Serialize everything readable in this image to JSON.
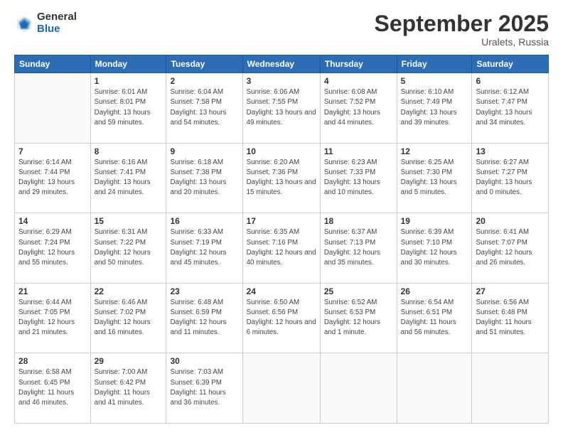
{
  "logo": {
    "general": "General",
    "blue": "Blue"
  },
  "header": {
    "title": "September 2025",
    "subtitle": "Uralets, Russia"
  },
  "days_of_week": [
    "Sunday",
    "Monday",
    "Tuesday",
    "Wednesday",
    "Thursday",
    "Friday",
    "Saturday"
  ],
  "weeks": [
    [
      {
        "day": "",
        "sunrise": "",
        "sunset": "",
        "daylight": ""
      },
      {
        "day": "1",
        "sunrise": "Sunrise: 6:01 AM",
        "sunset": "Sunset: 8:01 PM",
        "daylight": "Daylight: 13 hours and 59 minutes."
      },
      {
        "day": "2",
        "sunrise": "Sunrise: 6:04 AM",
        "sunset": "Sunset: 7:58 PM",
        "daylight": "Daylight: 13 hours and 54 minutes."
      },
      {
        "day": "3",
        "sunrise": "Sunrise: 6:06 AM",
        "sunset": "Sunset: 7:55 PM",
        "daylight": "Daylight: 13 hours and 49 minutes."
      },
      {
        "day": "4",
        "sunrise": "Sunrise: 6:08 AM",
        "sunset": "Sunset: 7:52 PM",
        "daylight": "Daylight: 13 hours and 44 minutes."
      },
      {
        "day": "5",
        "sunrise": "Sunrise: 6:10 AM",
        "sunset": "Sunset: 7:49 PM",
        "daylight": "Daylight: 13 hours and 39 minutes."
      },
      {
        "day": "6",
        "sunrise": "Sunrise: 6:12 AM",
        "sunset": "Sunset: 7:47 PM",
        "daylight": "Daylight: 13 hours and 34 minutes."
      }
    ],
    [
      {
        "day": "7",
        "sunrise": "Sunrise: 6:14 AM",
        "sunset": "Sunset: 7:44 PM",
        "daylight": "Daylight: 13 hours and 29 minutes."
      },
      {
        "day": "8",
        "sunrise": "Sunrise: 6:16 AM",
        "sunset": "Sunset: 7:41 PM",
        "daylight": "Daylight: 13 hours and 24 minutes."
      },
      {
        "day": "9",
        "sunrise": "Sunrise: 6:18 AM",
        "sunset": "Sunset: 7:38 PM",
        "daylight": "Daylight: 13 hours and 20 minutes."
      },
      {
        "day": "10",
        "sunrise": "Sunrise: 6:20 AM",
        "sunset": "Sunset: 7:36 PM",
        "daylight": "Daylight: 13 hours and 15 minutes."
      },
      {
        "day": "11",
        "sunrise": "Sunrise: 6:23 AM",
        "sunset": "Sunset: 7:33 PM",
        "daylight": "Daylight: 13 hours and 10 minutes."
      },
      {
        "day": "12",
        "sunrise": "Sunrise: 6:25 AM",
        "sunset": "Sunset: 7:30 PM",
        "daylight": "Daylight: 13 hours and 5 minutes."
      },
      {
        "day": "13",
        "sunrise": "Sunrise: 6:27 AM",
        "sunset": "Sunset: 7:27 PM",
        "daylight": "Daylight: 13 hours and 0 minutes."
      }
    ],
    [
      {
        "day": "14",
        "sunrise": "Sunrise: 6:29 AM",
        "sunset": "Sunset: 7:24 PM",
        "daylight": "Daylight: 12 hours and 55 minutes."
      },
      {
        "day": "15",
        "sunrise": "Sunrise: 6:31 AM",
        "sunset": "Sunset: 7:22 PM",
        "daylight": "Daylight: 12 hours and 50 minutes."
      },
      {
        "day": "16",
        "sunrise": "Sunrise: 6:33 AM",
        "sunset": "Sunset: 7:19 PM",
        "daylight": "Daylight: 12 hours and 45 minutes."
      },
      {
        "day": "17",
        "sunrise": "Sunrise: 6:35 AM",
        "sunset": "Sunset: 7:16 PM",
        "daylight": "Daylight: 12 hours and 40 minutes."
      },
      {
        "day": "18",
        "sunrise": "Sunrise: 6:37 AM",
        "sunset": "Sunset: 7:13 PM",
        "daylight": "Daylight: 12 hours and 35 minutes."
      },
      {
        "day": "19",
        "sunrise": "Sunrise: 6:39 AM",
        "sunset": "Sunset: 7:10 PM",
        "daylight": "Daylight: 12 hours and 30 minutes."
      },
      {
        "day": "20",
        "sunrise": "Sunrise: 6:41 AM",
        "sunset": "Sunset: 7:07 PM",
        "daylight": "Daylight: 12 hours and 26 minutes."
      }
    ],
    [
      {
        "day": "21",
        "sunrise": "Sunrise: 6:44 AM",
        "sunset": "Sunset: 7:05 PM",
        "daylight": "Daylight: 12 hours and 21 minutes."
      },
      {
        "day": "22",
        "sunrise": "Sunrise: 6:46 AM",
        "sunset": "Sunset: 7:02 PM",
        "daylight": "Daylight: 12 hours and 16 minutes."
      },
      {
        "day": "23",
        "sunrise": "Sunrise: 6:48 AM",
        "sunset": "Sunset: 6:59 PM",
        "daylight": "Daylight: 12 hours and 11 minutes."
      },
      {
        "day": "24",
        "sunrise": "Sunrise: 6:50 AM",
        "sunset": "Sunset: 6:56 PM",
        "daylight": "Daylight: 12 hours and 6 minutes."
      },
      {
        "day": "25",
        "sunrise": "Sunrise: 6:52 AM",
        "sunset": "Sunset: 6:53 PM",
        "daylight": "Daylight: 12 hours and 1 minute."
      },
      {
        "day": "26",
        "sunrise": "Sunrise: 6:54 AM",
        "sunset": "Sunset: 6:51 PM",
        "daylight": "Daylight: 11 hours and 56 minutes."
      },
      {
        "day": "27",
        "sunrise": "Sunrise: 6:56 AM",
        "sunset": "Sunset: 6:48 PM",
        "daylight": "Daylight: 11 hours and 51 minutes."
      }
    ],
    [
      {
        "day": "28",
        "sunrise": "Sunrise: 6:58 AM",
        "sunset": "Sunset: 6:45 PM",
        "daylight": "Daylight: 11 hours and 46 minutes."
      },
      {
        "day": "29",
        "sunrise": "Sunrise: 7:00 AM",
        "sunset": "Sunset: 6:42 PM",
        "daylight": "Daylight: 11 hours and 41 minutes."
      },
      {
        "day": "30",
        "sunrise": "Sunrise: 7:03 AM",
        "sunset": "Sunset: 6:39 PM",
        "daylight": "Daylight: 11 hours and 36 minutes."
      },
      {
        "day": "",
        "sunrise": "",
        "sunset": "",
        "daylight": ""
      },
      {
        "day": "",
        "sunrise": "",
        "sunset": "",
        "daylight": ""
      },
      {
        "day": "",
        "sunrise": "",
        "sunset": "",
        "daylight": ""
      },
      {
        "day": "",
        "sunrise": "",
        "sunset": "",
        "daylight": ""
      }
    ]
  ]
}
